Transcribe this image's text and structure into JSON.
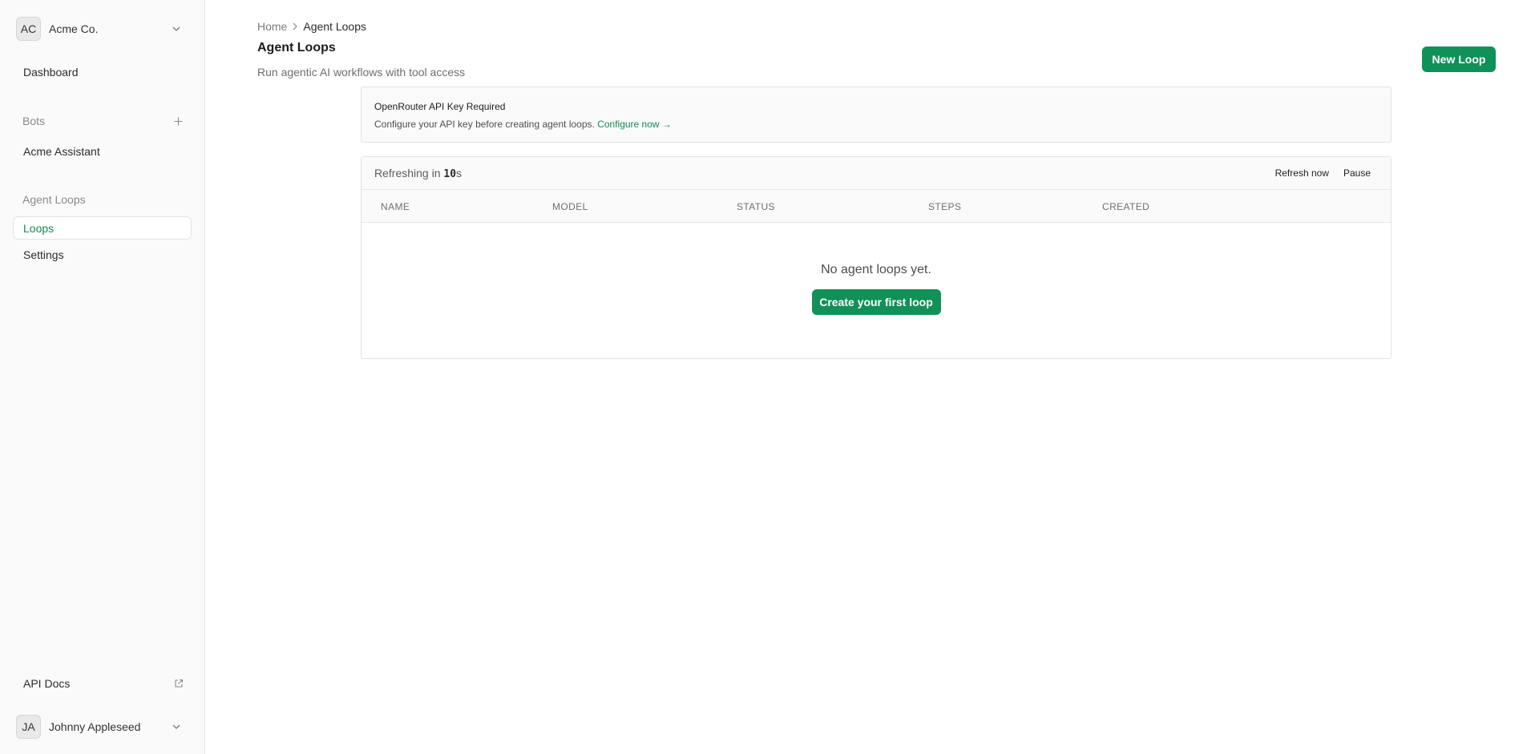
{
  "org": {
    "initials": "AC",
    "name": "Acme Co."
  },
  "sidebar": {
    "dashboard_label": "Dashboard",
    "bots_section_label": "Bots",
    "bots": [
      {
        "label": "Acme Assistant"
      }
    ],
    "agent_loops_section_label": "Agent Loops",
    "agent_loop_items": [
      {
        "label": "Loops",
        "active": true
      },
      {
        "label": "Settings",
        "active": false
      }
    ],
    "api_docs_label": "API Docs"
  },
  "user": {
    "initials": "JA",
    "name": "Johnny Appleseed"
  },
  "breadcrumb": {
    "home": "Home",
    "current": "Agent Loops"
  },
  "page": {
    "title": "Agent Loops",
    "subtitle": "Run agentic AI workflows with tool access",
    "new_button_label": "New Loop"
  },
  "alert": {
    "title": "OpenRouter API Key Required",
    "description": "Configure your API key before creating agent loops.",
    "link_label": "Configure now →"
  },
  "refresh": {
    "prefix": "Refreshing in ",
    "count": "10",
    "suffix": "s",
    "refresh_now_label": "Refresh now",
    "pause_label": "Pause"
  },
  "table": {
    "columns": [
      "NAME",
      "MODEL",
      "STATUS",
      "STEPS",
      "CREATED"
    ],
    "empty_message": "No agent loops yet.",
    "create_button_label": "Create your first loop"
  },
  "colors": {
    "accent": "#0f9158",
    "link": "#138a55",
    "sidebar_bg": "#fafafa"
  }
}
